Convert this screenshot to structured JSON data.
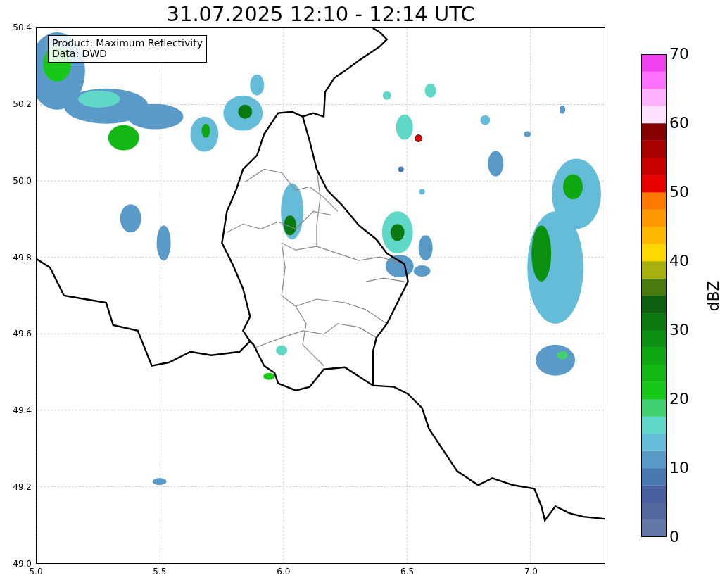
{
  "title": "31.07.2025 12:10 - 12:14 UTC",
  "legend": [
    "Product: Maximum Reflectivity",
    "Data: DWD"
  ],
  "y_axis": {
    "ticks": [
      "50.4",
      "50.2",
      "50.0",
      "49.8",
      "49.6",
      "49.4",
      "49.2",
      "49.0"
    ]
  },
  "x_axis": {
    "ticks": [
      "5.0",
      "5.5",
      "6.0",
      "6.5",
      "7.0"
    ]
  },
  "colorbar": {
    "label": "dBZ",
    "ticks": [
      "70",
      "60",
      "50",
      "40",
      "30",
      "20",
      "10",
      "0"
    ]
  }
}
